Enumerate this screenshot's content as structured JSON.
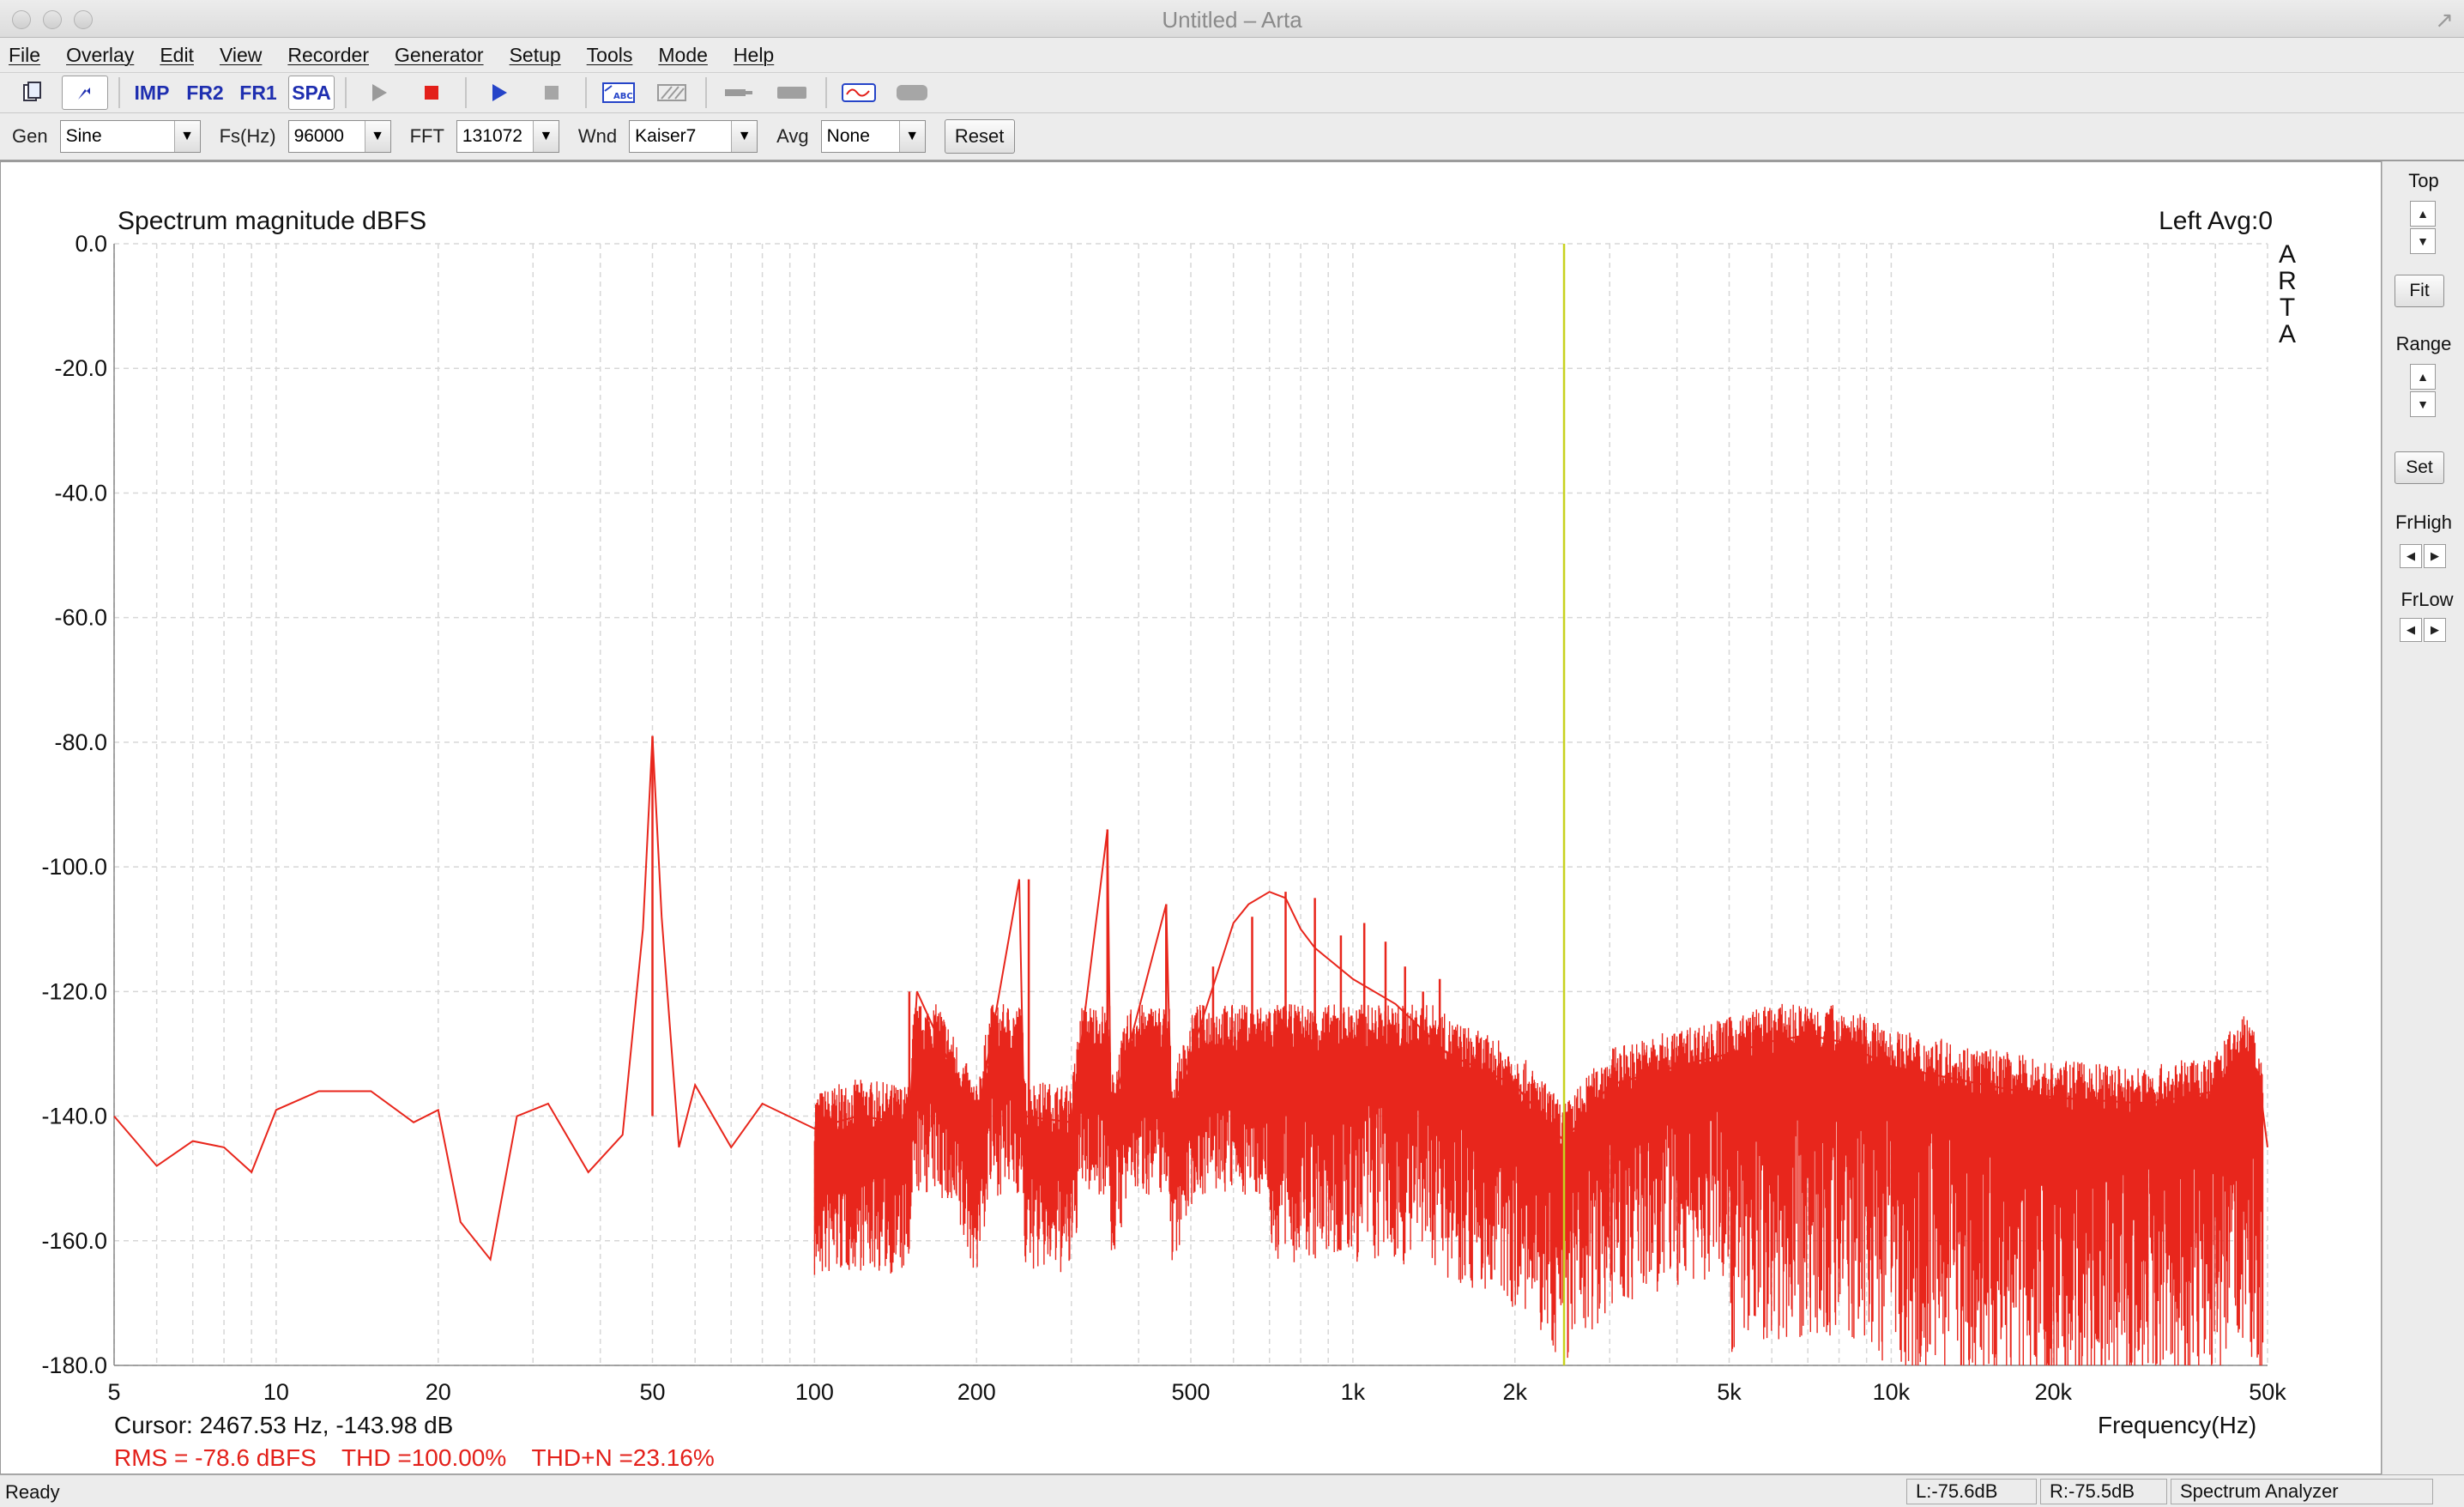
{
  "window": {
    "title": "Untitled – Arta"
  },
  "menu": [
    "File",
    "Overlay",
    "Edit",
    "View",
    "Recorder",
    "Generator",
    "Setup",
    "Tools",
    "Mode",
    "Help"
  ],
  "toolbar": {
    "imp": "IMP",
    "fr2": "FR2",
    "fr1": "FR1",
    "spa": "SPA"
  },
  "params": {
    "gen_label": "Gen",
    "gen_value": "Sine",
    "fs_label": "Fs(Hz)",
    "fs_value": "96000",
    "fft_label": "FFT",
    "fft_value": "131072",
    "wnd_label": "Wnd",
    "wnd_value": "Kaiser7",
    "avg_label": "Avg",
    "avg_value": "None",
    "reset_label": "Reset"
  },
  "plot": {
    "title": "Spectrum magnitude dBFS",
    "channel": "Left  Avg:0",
    "logo": [
      "A",
      "R",
      "T",
      "A"
    ],
    "cursor": "Cursor: 2467.53 Hz, -143.98 dB",
    "rms": "RMS =  -78.6 dBFS",
    "thd": "THD =100.00%",
    "thdn": "THD+N =23.16%",
    "xlabel": "Frequency(Hz)"
  },
  "chart_data": {
    "type": "line",
    "title": "Spectrum magnitude dBFS",
    "xlabel": "Frequency(Hz)",
    "ylabel": "",
    "x_scale": "log",
    "xlim": [
      5,
      50000
    ],
    "ylim": [
      -180,
      0
    ],
    "grid": true,
    "x_ticks": [
      "5",
      "10",
      "20",
      "50",
      "100",
      "200",
      "500",
      "1k",
      "2k",
      "5k",
      "10k",
      "20k",
      "50k"
    ],
    "x_tick_values": [
      5,
      10,
      20,
      50,
      100,
      200,
      500,
      1000,
      2000,
      5000,
      10000,
      20000,
      50000
    ],
    "y_ticks": [
      "0.0",
      "-20.0",
      "-40.0",
      "-60.0",
      "-80.0",
      "-100.0",
      "-120.0",
      "-140.0",
      "-160.0",
      "-180.0"
    ],
    "y_tick_values": [
      0,
      -20,
      -40,
      -60,
      -80,
      -100,
      -120,
      -140,
      -160,
      -180
    ],
    "cursor_hz": 2467.53,
    "cursor_color": "#c8d21e",
    "series": [
      {
        "color": "#e8261c",
        "x": [
          5,
          6,
          7,
          8,
          9,
          10,
          12,
          15,
          18,
          20,
          22,
          25,
          28,
          32,
          38,
          44,
          48,
          50,
          52,
          56,
          60,
          70,
          80,
          100,
          120,
          150,
          155,
          200,
          240,
          245,
          300,
          350,
          355,
          450,
          460,
          600,
          640,
          700,
          750,
          800,
          850,
          1000,
          1200,
          1500,
          2000,
          2467,
          3000,
          4000,
          5000,
          6000,
          7000,
          8000,
          10000,
          15000,
          20000,
          30000,
          40000,
          45000,
          48000,
          50000
        ],
        "y": [
          -140,
          -148,
          -144,
          -145,
          -149,
          -139,
          -136,
          -136,
          -141,
          -139,
          -157,
          -163,
          -140,
          -138,
          -149,
          -143,
          -110,
          -79,
          -108,
          -145,
          -135,
          -145,
          -138,
          -142,
          -140,
          -141,
          -120,
          -141,
          -102,
          -140,
          -141,
          -94,
          -140,
          -106,
          -140,
          -109,
          -106,
          -104,
          -105,
          -110,
          -113,
          -118,
          -122,
          -130,
          -135,
          -144,
          -135,
          -132,
          -130,
          -128,
          -127,
          -128,
          -132,
          -135,
          -137,
          -138,
          -136,
          -129,
          -133,
          -145
        ]
      }
    ],
    "harmonics": [
      {
        "x": 50,
        "y": -79
      },
      {
        "x": 150,
        "y": -120
      },
      {
        "x": 250,
        "y": -102
      },
      {
        "x": 350,
        "y": -94
      },
      {
        "x": 450,
        "y": -106
      },
      {
        "x": 550,
        "y": -116
      },
      {
        "x": 650,
        "y": -108
      },
      {
        "x": 750,
        "y": -104
      },
      {
        "x": 850,
        "y": -105
      },
      {
        "x": 950,
        "y": -111
      },
      {
        "x": 1050,
        "y": -109
      },
      {
        "x": 1150,
        "y": -112
      },
      {
        "x": 1250,
        "y": -116
      },
      {
        "x": 1350,
        "y": -120
      },
      {
        "x": 1450,
        "y": -118
      }
    ]
  },
  "right_panel": {
    "top_label": "Top",
    "fit_label": "Fit",
    "range_label": "Range",
    "set_label": "Set",
    "frhigh_label": "FrHigh",
    "frlow_label": "FrLow"
  },
  "status": {
    "ready": "Ready",
    "left_level": "L:-75.6dB",
    "right_level": "R:-75.5dB",
    "mode": "Spectrum Analyzer"
  }
}
